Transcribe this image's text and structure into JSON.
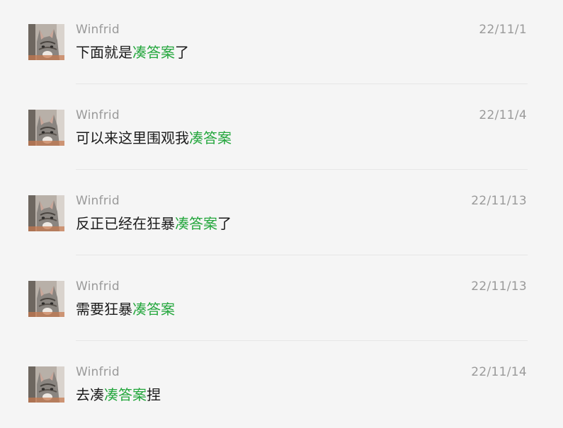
{
  "messages": [
    {
      "name": "Winfrid",
      "date": "22/11/1",
      "pre": "下面就是",
      "highlight": "凑答案",
      "post": "了"
    },
    {
      "name": "Winfrid",
      "date": "22/11/4",
      "pre": "可以来这里围观我",
      "highlight": "凑答案",
      "post": ""
    },
    {
      "name": "Winfrid",
      "date": "22/11/13",
      "pre": "反正已经在狂暴",
      "highlight": "凑答案",
      "post": "了"
    },
    {
      "name": "Winfrid",
      "date": "22/11/13",
      "pre": "需要狂暴",
      "highlight": "凑答案",
      "post": ""
    },
    {
      "name": "Winfrid",
      "date": "22/11/14",
      "pre": "去凑",
      "highlight": "凑答案",
      "post": "捏"
    }
  ],
  "colors": {
    "background": "#f5f5f5",
    "meta_text": "#9a9a9a",
    "message_text": "#1b1b1b",
    "highlight": "#23a63c",
    "divider": "#e6e6e6"
  },
  "icons": {
    "avatar": "cat-avatar-icon"
  }
}
